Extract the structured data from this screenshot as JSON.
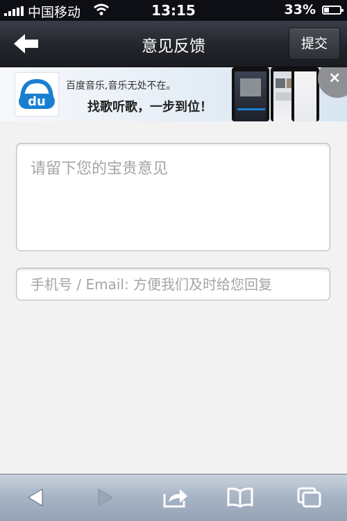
{
  "status_bar": {
    "carrier": "中国移动",
    "time": "13:15",
    "battery": "33%",
    "battery_level": 0.33
  },
  "nav": {
    "title": "意见反馈",
    "back_icon": "back-arrow-icon",
    "submit_label": "提交"
  },
  "banner": {
    "logo_text": "du",
    "line1": "百度音乐,音乐无处不在。",
    "line2": "找歌听歌，一步到位！",
    "close_label": "×"
  },
  "form": {
    "feedback_placeholder": "请留下您的宝贵意见",
    "feedback_value": "",
    "contact_placeholder": "手机号 / Email: 方便我们及时给您回复",
    "contact_value": ""
  },
  "toolbar": {
    "items": [
      "back-icon",
      "forward-icon",
      "share-icon",
      "bookmarks-icon",
      "tabs-icon"
    ]
  },
  "colors": {
    "accent_blue": "#1a7fd1",
    "nav_dark": "#23252c",
    "toolbar_blue": "#a6b3c4"
  }
}
